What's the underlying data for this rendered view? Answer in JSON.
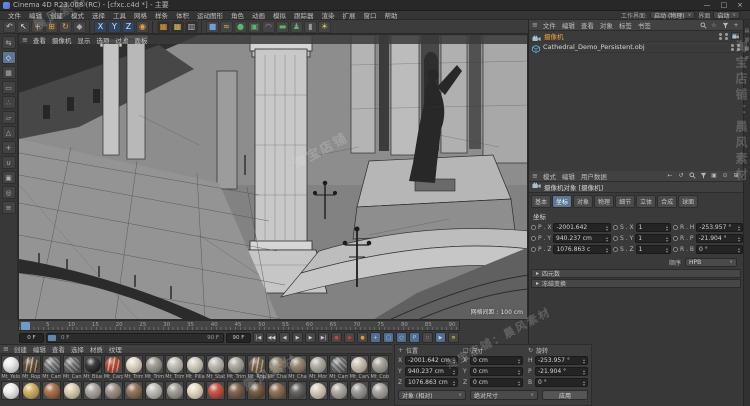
{
  "window": {
    "title": "Cinema 4D R23.008 (RC) - [cfxc.c4d *] - 主要",
    "minimize": "—",
    "maximize": "□",
    "close": "×"
  },
  "menubar": {
    "items": [
      "文件",
      "编辑",
      "创建",
      "模式",
      "选择",
      "工具",
      "网格",
      "样条",
      "体积",
      "运动图形",
      "角色",
      "动画",
      "模拟",
      "跟踪器",
      "渲染",
      "扩展",
      "窗口",
      "帮助"
    ],
    "workspace_label": "工作界面:",
    "workspace_value": "启动 (物理)",
    "layout_label": "界面",
    "layout_value": "启动",
    "dd_arrow": "∨"
  },
  "toolbar": {
    "tools": [
      {
        "name": "undo",
        "glyph": "↶",
        "color": "#c8c8c8"
      },
      {
        "name": "live-selection",
        "glyph": "↖",
        "color": "#e8e8e8"
      },
      {
        "name": "move-tool",
        "glyph": "+",
        "color": "#e8a23c"
      },
      {
        "name": "scale-tool",
        "glyph": "⊞",
        "color": "#e8a23c"
      },
      {
        "name": "rotate-tool",
        "glyph": "↻",
        "color": "#e8a23c"
      },
      {
        "name": "last-used-tool",
        "glyph": "◆",
        "color": "#a8a8a8"
      },
      {
        "name": "sep"
      },
      {
        "name": "x-axis-lock",
        "glyph": "X",
        "bg": "#2e4662",
        "color": "#cfe2f4"
      },
      {
        "name": "y-axis-lock",
        "glyph": "Y",
        "bg": "#2e4662",
        "color": "#cfe2f4"
      },
      {
        "name": "z-axis-lock",
        "glyph": "Z",
        "bg": "#2e4662",
        "color": "#cfe2f4"
      },
      {
        "name": "coordinate-system",
        "glyph": "◉",
        "color": "#e8a23c"
      },
      {
        "name": "sep"
      },
      {
        "name": "render-view",
        "glyph": "▦",
        "color": "#e8a23c",
        "bg": "#303030"
      },
      {
        "name": "render-to-picture-viewer",
        "glyph": "▦",
        "color": "#e8c05a",
        "bg": "#303030"
      },
      {
        "name": "edit-render-settings",
        "glyph": "▥",
        "color": "#b8b8b8",
        "bg": "#303030"
      },
      {
        "name": "sep"
      },
      {
        "name": "add-primitive-cube",
        "glyph": "■",
        "color": "#6a9fd8"
      },
      {
        "name": "add-spline-pen",
        "glyph": "≈",
        "color": "#e8b050"
      },
      {
        "name": "add-subdivision-surface",
        "glyph": "●",
        "color": "#5cb868"
      },
      {
        "name": "add-generator",
        "glyph": "▣",
        "color": "#5cb868"
      },
      {
        "name": "add-deformer",
        "glyph": "◠",
        "color": "#b878c8"
      },
      {
        "name": "add-environment",
        "glyph": "▬",
        "color": "#5cb868"
      },
      {
        "name": "add-character",
        "glyph": "♟",
        "color": "#5cb868"
      },
      {
        "name": "add-camera",
        "glyph": "▮",
        "color": "#9a9a9a"
      },
      {
        "name": "add-light",
        "glyph": "☀",
        "color": "#e8d060"
      }
    ]
  },
  "left_toolbar": {
    "tools": [
      {
        "name": "convert-editable",
        "glyph": "⇆"
      },
      {
        "name": "model-mode",
        "glyph": "◇",
        "active": true
      },
      {
        "name": "texture-mode",
        "glyph": "▦"
      },
      {
        "name": "workplane-mode",
        "glyph": "▭"
      },
      {
        "name": "points-mode",
        "glyph": "∴"
      },
      {
        "name": "edges-mode",
        "glyph": "▱"
      },
      {
        "name": "polygons-mode",
        "glyph": "△"
      },
      {
        "name": "enable-axis",
        "glyph": "+"
      },
      {
        "name": "snap-settings",
        "glyph": "∪"
      },
      {
        "name": "workplane-lock",
        "glyph": "▣"
      },
      {
        "name": "viewport-filter",
        "glyph": "◎"
      },
      {
        "name": "layer-shortcut",
        "glyph": "≡"
      }
    ]
  },
  "viewport": {
    "menus": [
      "查看",
      "摄像机",
      "显示",
      "选项",
      "过滤",
      "面板"
    ],
    "grid_spacing": "网格间距 : 100 cm"
  },
  "object_manager": {
    "menus": [
      "文件",
      "编辑",
      "查看",
      "对象",
      "标签",
      "书签"
    ],
    "toolbar_icons": [
      "search",
      "star",
      "filter",
      "add"
    ],
    "objects": [
      {
        "name": "摄像机",
        "color": "#f0a23c",
        "icon": "camera",
        "has_tag": true
      },
      {
        "name": "Cathedral_Demo_Persistent.obj",
        "color": "#d6d6d6",
        "icon": "mesh",
        "has_tag": false
      }
    ]
  },
  "attributes": {
    "menus": [
      "模式",
      "编辑",
      "用户数据"
    ],
    "toolbar_icons": [
      "back",
      "history",
      "search",
      "filter",
      "lock",
      "pin",
      "grid"
    ],
    "object_title": "摄像机对象 [摄像机]",
    "tabs": [
      "基本",
      "坐标",
      "对象",
      "物理",
      "细节",
      "立体",
      "合成",
      "球面"
    ],
    "active_tab": "坐标",
    "section": "坐标",
    "columns": [
      {
        "rows": [
          [
            "P . X",
            "-2001.642"
          ],
          [
            "P . Y",
            "940.237 cm"
          ],
          [
            "P . Z",
            "1076.863 c"
          ]
        ]
      },
      {
        "rows": [
          [
            "S . X",
            "1"
          ],
          [
            "S . Y",
            "1"
          ],
          [
            "S . Z",
            "1"
          ]
        ]
      },
      {
        "rows": [
          [
            "R . H",
            "-253.957 °"
          ],
          [
            "R . P",
            "-21.904 °"
          ],
          [
            "R . B",
            "0 °"
          ]
        ]
      }
    ],
    "order_label": "顺序",
    "order_value": "HPB",
    "collapsed_sections": [
      "四元数",
      "冻结变换"
    ]
  },
  "timeline": {
    "tick_labels": [
      "0",
      "5",
      "10",
      "15",
      "20",
      "25",
      "30",
      "35",
      "40",
      "45",
      "50",
      "55",
      "60",
      "65",
      "70",
      "75",
      "80",
      "85",
      "90"
    ],
    "current_frame": "0 F",
    "range_start": "0 F",
    "range_end": "90 F",
    "end_box": "90 F",
    "transport": [
      {
        "name": "goto-start",
        "glyph": "|◀"
      },
      {
        "name": "prev-key",
        "glyph": "◀◀"
      },
      {
        "name": "prev-frame",
        "glyph": "◀"
      },
      {
        "name": "play",
        "glyph": "▶"
      },
      {
        "name": "next-frame",
        "glyph": "▶"
      },
      {
        "name": "goto-end",
        "glyph": "▶|"
      },
      {
        "name": "record-keyframe",
        "glyph": "●",
        "color": "#d04438"
      },
      {
        "name": "autokeying",
        "glyph": "◉",
        "color": "#d04438"
      },
      {
        "name": "keyframe-presets",
        "glyph": "●",
        "color": "#e09a3c"
      },
      {
        "name": "key-position",
        "glyph": "+",
        "bg": "#4e6f93",
        "color": "#f0d0a0"
      },
      {
        "name": "key-scale",
        "glyph": "□",
        "bg": "#4e6f93"
      },
      {
        "name": "key-rotation",
        "glyph": "○",
        "bg": "#4e6f93"
      },
      {
        "name": "key-parameter",
        "glyph": "P",
        "bg": "#4e6f93"
      },
      {
        "name": "key-pla",
        "glyph": "∷"
      },
      {
        "name": "solo-mode",
        "glyph": "▶",
        "bg": "#4e6f93"
      },
      {
        "name": "keyframe-list",
        "glyph": "≣",
        "color": "#d8c050"
      }
    ]
  },
  "materials": {
    "menus": [
      "创建",
      "编辑",
      "查看",
      "选择",
      "材质",
      "纹理"
    ],
    "row1": [
      {
        "name": "Mt_Yelo",
        "color": "#e8e8e6"
      },
      {
        "name": "Mt_Rop",
        "color": "#56422c",
        "pattern": "stripe"
      },
      {
        "name": "Mt_Cam",
        "color": "#909090",
        "pattern": "checker"
      },
      {
        "name": "Mt_Can",
        "color": "#8a8a8a",
        "pattern": "checker"
      },
      {
        "name": "Mt_Blue",
        "color": "#161616"
      },
      {
        "name": "Mt_Carp",
        "color": "#ad402c",
        "pattern": "stripe"
      },
      {
        "name": "Mt_Trim",
        "color": "#dbd2bd"
      },
      {
        "name": "Mt_Trim",
        "color": "#918d85"
      },
      {
        "name": "Mt_Trim",
        "color": "#bab6ad"
      },
      {
        "name": "Mt_Pilla",
        "color": "#ccc6b6"
      },
      {
        "name": "Mt_Stab",
        "color": "#b2aea4"
      },
      {
        "name": "Mt_Trim",
        "color": "#a09c92"
      },
      {
        "name": "Mt_Rop",
        "color": "#6b573f",
        "pattern": "stripe"
      },
      {
        "name": "Mt_Chai",
        "color": "#7e6c52"
      },
      {
        "name": "Mt_Chai",
        "color": "#84725a"
      },
      {
        "name": "Mt_Mor",
        "color": "#a6a198"
      },
      {
        "name": "Mt_Cam",
        "color": "#8e8e8e",
        "pattern": "checker"
      },
      {
        "name": "Mt_Carv",
        "color": "#c2baa8"
      },
      {
        "name": "Mt_Cob",
        "color": "#99958b"
      }
    ],
    "row2_colors": [
      "#eeeeec",
      "#c9a44e",
      "#9c5a30",
      "#d6c8a4",
      "#9c988e",
      "#8b8178",
      "#7e5e42",
      "#b7b3ab",
      "#928e86",
      "#e2d6ba",
      "#bf392b",
      "#6c4c32",
      "#5c4228",
      "#7c5a3c",
      "#4c4a46",
      "#d0c5af",
      "#a29e96",
      "#8c8882",
      "#9a9690"
    ]
  },
  "coords_panel": {
    "groups": [
      {
        "title": "位置",
        "icon": "+",
        "rows": [
          [
            "X",
            "-2001.642 cm"
          ],
          [
            "Y",
            "940.237 cm"
          ],
          [
            "Z",
            "1076.863 cm"
          ]
        ]
      },
      {
        "title": "尺寸",
        "icon": "□",
        "rows": [
          [
            "X",
            "0 cm"
          ],
          [
            "Y",
            "0 cm"
          ],
          [
            "Z",
            "0 cm"
          ]
        ]
      },
      {
        "title": "旋转",
        "icon": "↻",
        "rows": [
          [
            "H",
            "-253.957 °"
          ],
          [
            "P",
            "-21.904 °"
          ],
          [
            "B",
            "0 °"
          ]
        ]
      }
    ],
    "mode_dropdown": "对象 (相对)",
    "size_dropdown": "绝对尺寸",
    "apply_label": "应用",
    "dd_arrow": "∨"
  },
  "watermarks": [
    "晨风素材",
    "淘宝店铺：晨风素材",
    "淘宝店铺",
    "晨风素材",
    "淘宝店铺：晨风素材"
  ]
}
